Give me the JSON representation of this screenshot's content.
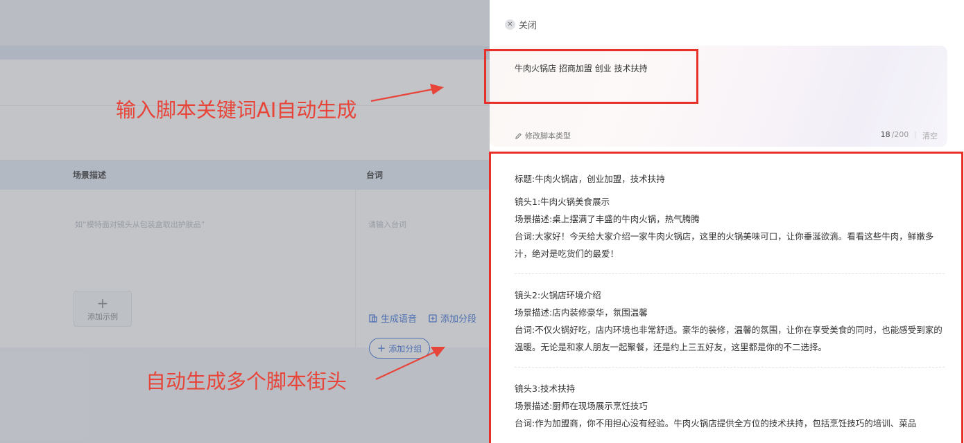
{
  "background": {
    "table_headers": [
      "场景描述",
      "台词"
    ],
    "scene_placeholder": "如“模特面对镜头从包装盒取出护肤品”",
    "line_placeholder": "请输入台词",
    "add_example_label": "添加示例",
    "generate_voice_label": "生成语音",
    "add_segment_label": "添加分段",
    "add_group_label": "添加分组"
  },
  "annotations": {
    "top": "输入脚本关键词AI自动生成",
    "bottom": "自动生成多个脚本街头"
  },
  "drawer": {
    "close_label": "关闭",
    "prompt_text": "牛肉火锅店 招商加盟 创业 技术扶持",
    "edit_type_label": "修改脚本类型",
    "char_count": "18",
    "char_max": "/200",
    "clear_label": "清空",
    "script": {
      "title": "标题:牛肉火锅店，创业加盟，技术扶持",
      "shots": [
        {
          "heading": "镜头1:牛肉火锅美食展示",
          "scene": "场景描述:桌上摆满了丰盛的牛肉火锅，热气腾腾",
          "line": "台词:大家好！今天给大家介绍一家牛肉火锅店，这里的火锅美味可口，让你垂涎欲滴。看看这些牛肉，鲜嫩多汁，绝对是吃货们的最爱！"
        },
        {
          "heading": "镜头2:火锅店环境介绍",
          "scene": "场景描述:店内装修豪华，氛围温馨",
          "line": "台词:不仅火锅好吃，店内环境也非常舒适。豪华的装修，温馨的氛围，让你在享受美食的同时，也能感受到家的温暖。无论是和家人朋友一起聚餐，还是约上三五好友，这里都是你的不二选择。"
        },
        {
          "heading": "镜头3:技术扶持",
          "scene": "场景描述:厨师在现场展示烹饪技巧",
          "line": "台词:作为加盟商，你不用担心没有经验。牛肉火锅店提供全方位的技术扶持，包括烹饪技巧的培训、菜品"
        }
      ]
    }
  },
  "colors": {
    "annotation_red": "#e8453a",
    "accent_blue": "#3a6ed8"
  }
}
